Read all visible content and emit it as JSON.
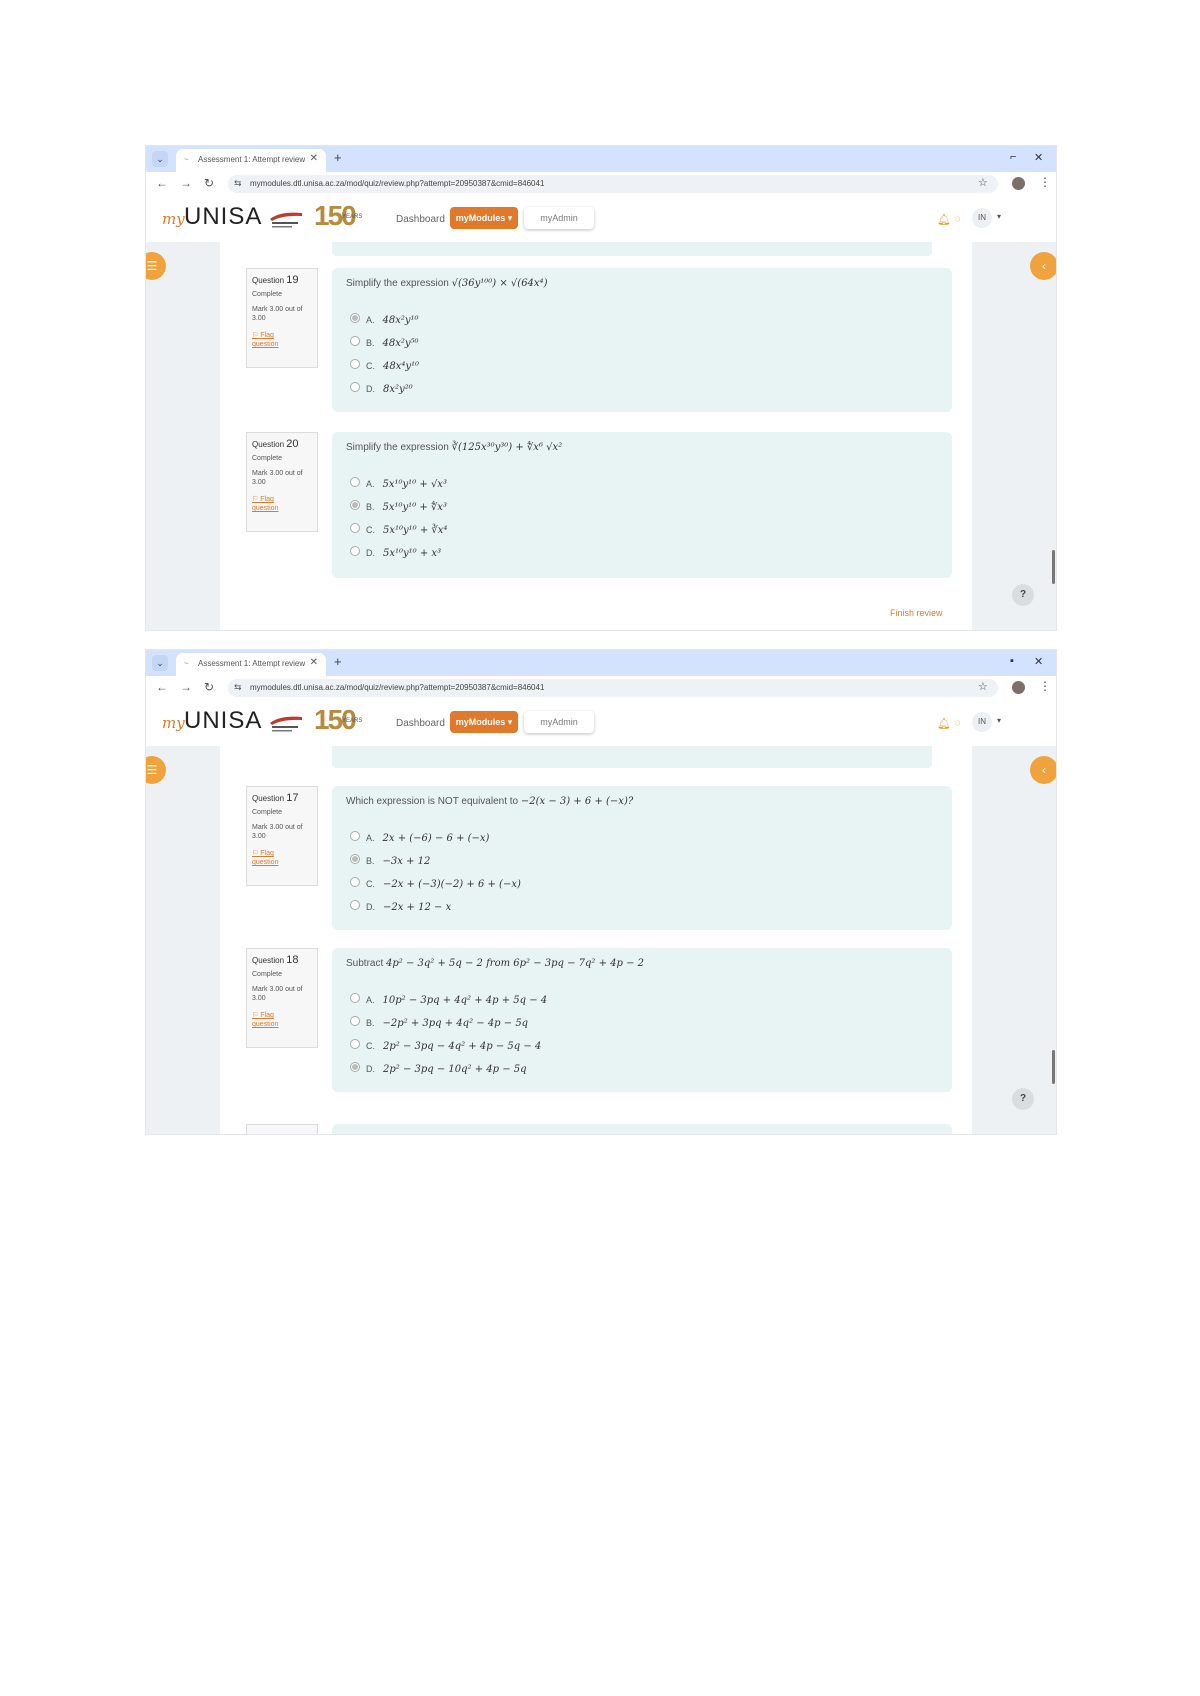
{
  "colors": {
    "accent": "#e1792b",
    "tabbar": "#d3e3fd",
    "question_bg": "#e8f3f3"
  },
  "screens": [
    {
      "browser": {
        "tab_title": "Assessment 1: Attempt review",
        "url": "mymodules.dtl.unisa.ac.za/mod/quiz/review.php?attempt=20950387&cmid=846041"
      },
      "header": {
        "logo_my": "my",
        "logo_unisa": "UNISA",
        "logo_150": "150",
        "logo_150_sub": "YEARS",
        "nav_dashboard": "Dashboard",
        "nav_mymodules": "myModules ▾",
        "nav_myadmin": "myAdmin",
        "user_initials": "IN"
      },
      "prev_stub": "",
      "questions": [
        {
          "number_label": "Question",
          "number": "19",
          "state": "Complete",
          "mark": "Mark 3.00 out of 3.00",
          "flag": "Flag question",
          "prompt": "Simplify the expression",
          "expr": "√(36y¹⁰⁰) × √(64x⁴)",
          "options": [
            {
              "letter": "A.",
              "text": "48x²y¹⁰",
              "selected": true
            },
            {
              "letter": "B.",
              "text": "48x²y⁵⁰",
              "selected": false
            },
            {
              "letter": "C.",
              "text": "48x⁴y¹⁰",
              "selected": false
            },
            {
              "letter": "D.",
              "text": "8x²y²⁰",
              "selected": false
            }
          ]
        },
        {
          "number_label": "Question",
          "number": "20",
          "state": "Complete",
          "mark": "Mark 3.00 out of 3.00",
          "flag": "Flag question",
          "prompt": "Simplify the expression",
          "expr": "∛(125x³⁰y³⁰) + ∜x⁶ √x²",
          "options": [
            {
              "letter": "A.",
              "text": "5x¹⁰y¹⁰ + √x³",
              "selected": false
            },
            {
              "letter": "B.",
              "text": "5x¹⁰y¹⁰ + ∜x³",
              "selected": true
            },
            {
              "letter": "C.",
              "text": "5x¹⁰y¹⁰ + ∛x⁴",
              "selected": false
            },
            {
              "letter": "D.",
              "text": "5x¹⁰y¹⁰ + x³",
              "selected": false
            }
          ]
        }
      ],
      "finish_link": "Finish review",
      "help": "?"
    },
    {
      "browser": {
        "tab_title": "Assessment 1: Attempt review",
        "url": "mymodules.dtl.unisa.ac.za/mod/quiz/review.php?attempt=20950387&cmid=846041"
      },
      "header": {
        "logo_my": "my",
        "logo_unisa": "UNISA",
        "logo_150": "150",
        "logo_150_sub": "YEARS",
        "nav_dashboard": "Dashboard",
        "nav_mymodules": "myModules ▾",
        "nav_myadmin": "myAdmin",
        "user_initials": "IN"
      },
      "prev_stub": "",
      "questions": [
        {
          "number_label": "Question",
          "number": "17",
          "state": "Complete",
          "mark": "Mark 3.00 out of 3.00",
          "flag": "Flag question",
          "prompt": "Which expression is NOT equivalent to",
          "expr": "−2(x − 3) + 6 + (−x)?",
          "options": [
            {
              "letter": "A.",
              "text": "2x + (−6) − 6 + (−x)",
              "selected": false
            },
            {
              "letter": "B.",
              "text": "−3x + 12",
              "selected": true
            },
            {
              "letter": "C.",
              "text": "−2x + (−3)(−2) + 6 + (−x)",
              "selected": false
            },
            {
              "letter": "D.",
              "text": "−2x + 12 − x",
              "selected": false
            }
          ]
        },
        {
          "number_label": "Question",
          "number": "18",
          "state": "Complete",
          "mark": "Mark 3.00 out of 3.00",
          "flag": "Flag question",
          "prompt": "Subtract",
          "expr": "4p² − 3q² + 5q − 2 from 6p² − 3pq − 7q² + 4p − 2",
          "options": [
            {
              "letter": "A.",
              "text": "10p² − 3pq + 4q² + 4p + 5q − 4",
              "selected": false
            },
            {
              "letter": "B.",
              "text": "−2p² + 3pq + 4q² − 4p − 5q",
              "selected": false
            },
            {
              "letter": "C.",
              "text": "2p² − 3pq − 4q² + 4p − 5q − 4",
              "selected": false
            },
            {
              "letter": "D.",
              "text": "2p² − 3pq − 10q² + 4p − 5q",
              "selected": true
            }
          ]
        }
      ],
      "finish_link": "",
      "help": "?"
    }
  ]
}
